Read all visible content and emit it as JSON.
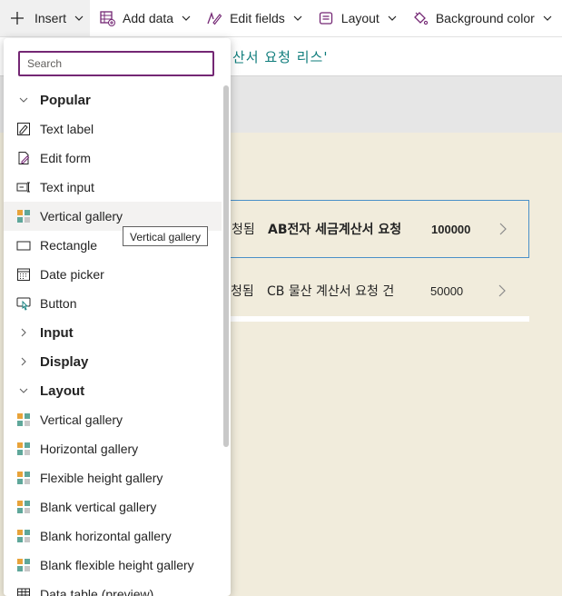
{
  "toolbar": {
    "insert_label": "Insert",
    "add_data_label": "Add data",
    "edit_fields_label": "Edit fields",
    "layout_label": "Layout",
    "background_color_label": "Background color"
  },
  "formula_bar": {
    "text": "산서 요청 리스'"
  },
  "gallery": {
    "rows": [
      {
        "status": "청됨",
        "title": "AB전자 세금계산서 요청",
        "amount": "100000"
      },
      {
        "status": "청됨",
        "title": "CB 물산 계산서 요청 건",
        "amount": "50000"
      }
    ]
  },
  "insert_panel": {
    "search_placeholder": "Search",
    "categories": {
      "popular": "Popular",
      "input": "Input",
      "display": "Display",
      "layout": "Layout"
    },
    "popular_items": [
      {
        "label": "Text label",
        "icon": "text-label-icon"
      },
      {
        "label": "Edit form",
        "icon": "edit-form-icon"
      },
      {
        "label": "Text input",
        "icon": "text-input-icon"
      },
      {
        "label": "Vertical gallery",
        "icon": "gallery-icon"
      },
      {
        "label": "Rectangle",
        "icon": "rectangle-icon"
      },
      {
        "label": "Date picker",
        "icon": "calendar-icon"
      },
      {
        "label": "Button",
        "icon": "button-icon"
      }
    ],
    "layout_items": [
      {
        "label": "Vertical gallery",
        "icon": "gallery-icon"
      },
      {
        "label": "Horizontal gallery",
        "icon": "gallery-icon"
      },
      {
        "label": "Flexible height gallery",
        "icon": "gallery-icon"
      },
      {
        "label": "Blank vertical gallery",
        "icon": "gallery-icon"
      },
      {
        "label": "Blank horizontal gallery",
        "icon": "gallery-icon"
      },
      {
        "label": "Blank flexible height gallery",
        "icon": "gallery-icon"
      },
      {
        "label": "Data table (preview)",
        "icon": "table-icon"
      }
    ],
    "tooltip": "Vertical gallery"
  },
  "colors": {
    "accent_purple": "#742774",
    "formula_teal": "#0e7c7b",
    "screen_background": "#f1ecdc",
    "gallery_selection": "#4a90c8"
  }
}
